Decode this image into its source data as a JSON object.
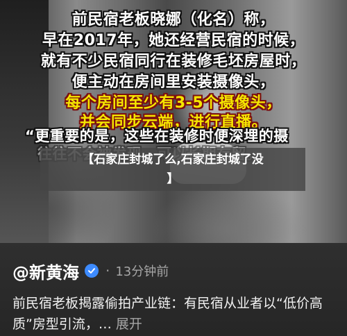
{
  "video": {
    "subtitles": [
      "前民宿老板晓娜（化名）称，",
      "早在2017年，她还经营民宿的时候，",
      "就有不少民宿同行在装修毛坯房屋时，",
      "便主动在房间里安装摄像头，",
      "每个房间至少有3-5个摄像头，",
      "并会同步云端，进行直播。",
      "“更重要的是，这些在装修时便深埋的摄",
      "往往不会被发现，可以长期存留。"
    ],
    "headline_line1": "【石家庄封城了么,石家庄封城了没",
    "headline_line2": "】"
  },
  "post": {
    "author": "@新黄海",
    "dot": "·",
    "time": "13分钟前",
    "text": "前民宿老板揭露偷拍产业链：有民宿从业者以“低价高质”房型引流，…",
    "expand": "展开"
  },
  "colors": {
    "subtitle_white": "#ffffff",
    "subtitle_yellow": "#f5e600",
    "verified_badge": "#3d8bff"
  }
}
